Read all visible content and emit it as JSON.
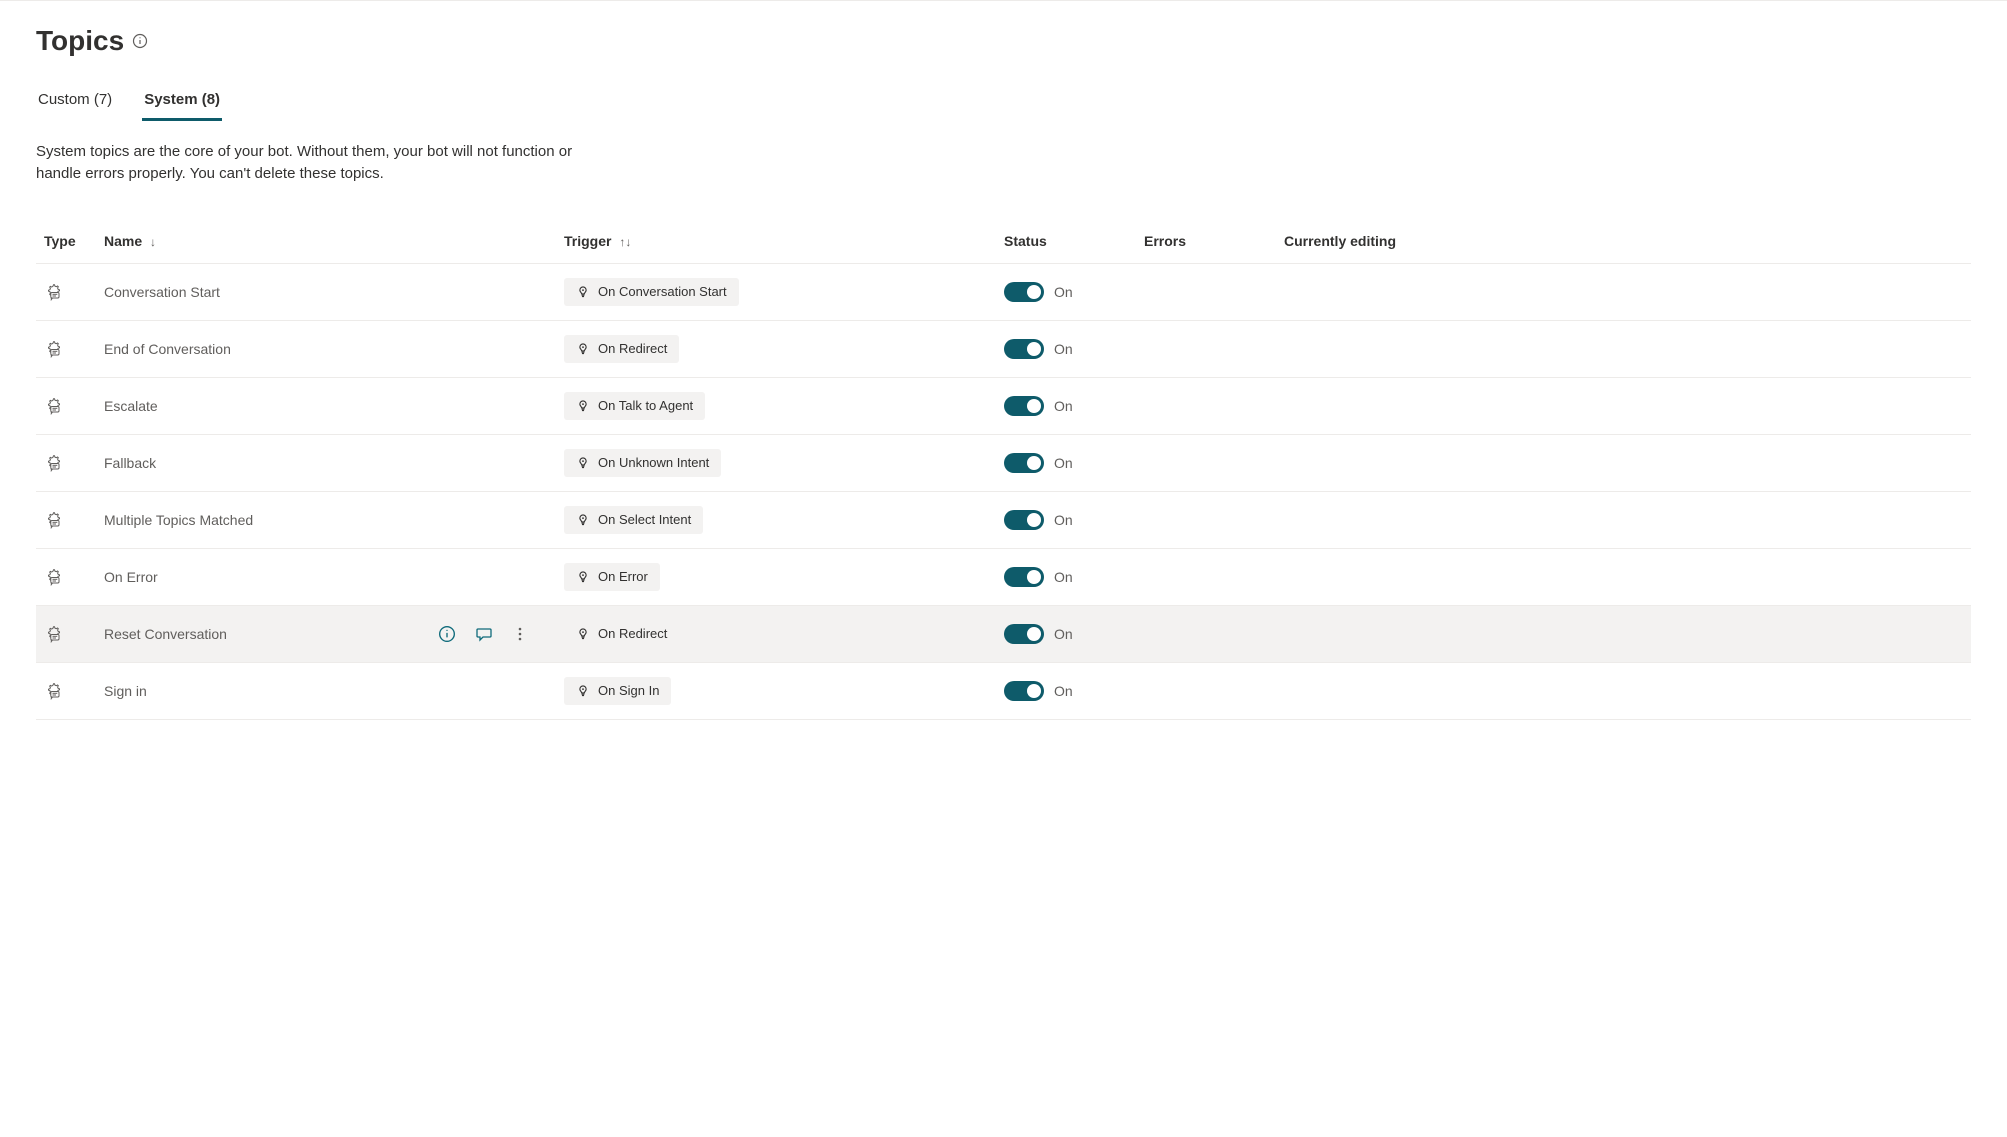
{
  "page": {
    "title": "Topics",
    "description": "System topics are the core of your bot. Without them, your bot will not function or handle errors properly. You can't delete these topics."
  },
  "tabs": [
    {
      "label": "Custom (7)",
      "active": false
    },
    {
      "label": "System (8)",
      "active": true
    }
  ],
  "columns": {
    "type": "Type",
    "name": "Name",
    "trigger": "Trigger",
    "status": "Status",
    "errors": "Errors",
    "editing": "Currently editing"
  },
  "status_label": "On",
  "rows": [
    {
      "name": "Conversation Start",
      "trigger": "On Conversation Start",
      "status": "On",
      "hovered": false
    },
    {
      "name": "End of Conversation",
      "trigger": "On Redirect",
      "status": "On",
      "hovered": false
    },
    {
      "name": "Escalate",
      "trigger": "On Talk to Agent",
      "status": "On",
      "hovered": false
    },
    {
      "name": "Fallback",
      "trigger": "On Unknown Intent",
      "status": "On",
      "hovered": false
    },
    {
      "name": "Multiple Topics Matched",
      "trigger": "On Select Intent",
      "status": "On",
      "hovered": false
    },
    {
      "name": "On Error",
      "trigger": "On Error",
      "status": "On",
      "hovered": false
    },
    {
      "name": "Reset Conversation",
      "trigger": "On Redirect",
      "status": "On",
      "hovered": true
    },
    {
      "name": "Sign in",
      "trigger": "On Sign In",
      "status": "On",
      "hovered": false
    }
  ]
}
